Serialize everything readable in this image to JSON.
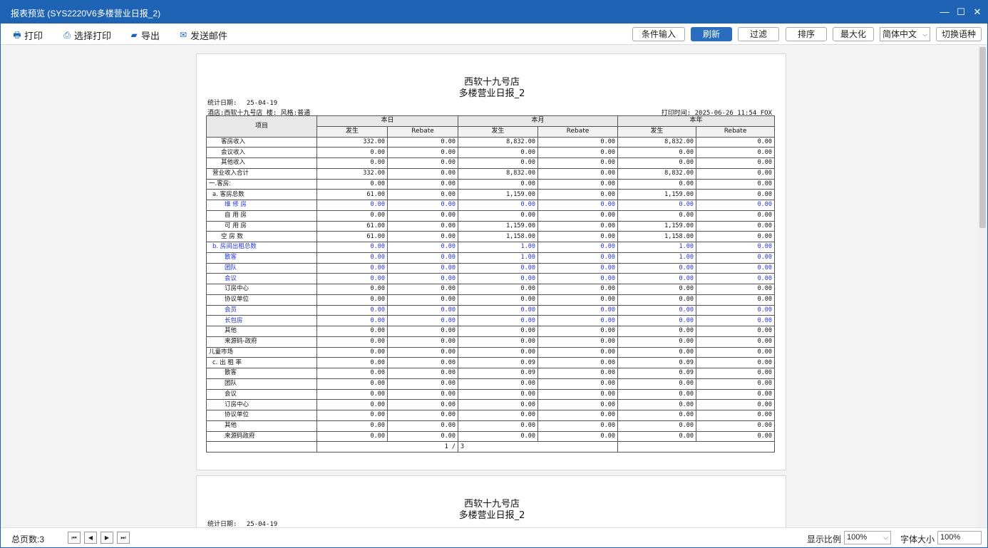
{
  "window": {
    "title": "报表预览 (SYS2220V6多楼营业日报_2)",
    "minimize": "—",
    "maximize": "☐",
    "close": "✕"
  },
  "toolbar": {
    "print": "打印",
    "select_print": "选择打印",
    "export": "导出",
    "send_mail": "发送邮件",
    "condition_input": "条件输入",
    "refresh": "刷新",
    "filter": "过滤",
    "sort": "排序",
    "maximize": "最大化",
    "language": "简体中文",
    "switch_language": "切换语种"
  },
  "report": {
    "hotel": "西软十九号店",
    "name": "多楼营业日报_2",
    "stat_date_label": "统计日期:",
    "stat_date": "25-04-19",
    "hotel_line": "酒店:西软十九号店 楼: 风格:普通",
    "print_time": "打印时间: 2025-06-26 11:54 FOX",
    "headers": {
      "item": "项目",
      "today": "本日",
      "month": "本月",
      "year": "本年",
      "occur": "发生",
      "rebate": "Rebate"
    },
    "rows": [
      {
        "item": "客房收入",
        "indent": 2,
        "blue": false,
        "v": [
          "332.00",
          "0.00",
          "8,832.00",
          "0.00",
          "8,832.00",
          "0.00"
        ]
      },
      {
        "item": "会议收入",
        "indent": 2,
        "blue": false,
        "v": [
          "0.00",
          "0.00",
          "0.00",
          "0.00",
          "0.00",
          "0.00"
        ]
      },
      {
        "item": "其他收入",
        "indent": 2,
        "blue": false,
        "v": [
          "0.00",
          "0.00",
          "0.00",
          "0.00",
          "0.00",
          "0.00"
        ]
      },
      {
        "item": "营业收入合计",
        "indent": 1,
        "blue": false,
        "v": [
          "332.00",
          "0.00",
          "8,832.00",
          "0.00",
          "8,832.00",
          "0.00"
        ]
      },
      {
        "item": "一.客房:",
        "indent": 0,
        "blue": false,
        "v": [
          "0.00",
          "0.00",
          "0.00",
          "0.00",
          "0.00",
          "0.00"
        ]
      },
      {
        "item": "a. 客房总数",
        "indent": 1,
        "blue": false,
        "v": [
          "61.00",
          "0.00",
          "1,159.00",
          "0.00",
          "1,159.00",
          "0.00"
        ]
      },
      {
        "item": "维 修 房",
        "indent": 3,
        "blue": true,
        "v": [
          "0.00",
          "0.00",
          "0.00",
          "0.00",
          "0.00",
          "0.00"
        ]
      },
      {
        "item": "自 用 房",
        "indent": 3,
        "blue": false,
        "v": [
          "0.00",
          "0.00",
          "0.00",
          "0.00",
          "0.00",
          "0.00"
        ]
      },
      {
        "item": "可 用 房",
        "indent": 3,
        "blue": false,
        "v": [
          "61.00",
          "0.00",
          "1,159.00",
          "0.00",
          "1,159.00",
          "0.00"
        ]
      },
      {
        "item": "空 房 数",
        "indent": 2,
        "blue": false,
        "v": [
          "61.00",
          "0.00",
          "1,158.00",
          "0.00",
          "1,158.00",
          "0.00"
        ]
      },
      {
        "item": "b. 房间出租总数",
        "indent": 1,
        "blue": true,
        "v": [
          "0.00",
          "0.00",
          "1.00",
          "0.00",
          "1.00",
          "0.00"
        ]
      },
      {
        "item": "散客",
        "indent": 3,
        "blue": true,
        "v": [
          "0.00",
          "0.00",
          "1.00",
          "0.00",
          "1.00",
          "0.00"
        ]
      },
      {
        "item": "团队",
        "indent": 3,
        "blue": true,
        "v": [
          "0.00",
          "0.00",
          "0.00",
          "0.00",
          "0.00",
          "0.00"
        ]
      },
      {
        "item": "会议",
        "indent": 3,
        "blue": true,
        "v": [
          "0.00",
          "0.00",
          "0.00",
          "0.00",
          "0.00",
          "0.00"
        ]
      },
      {
        "item": "订房中心",
        "indent": 3,
        "blue": false,
        "v": [
          "0.00",
          "0.00",
          "0.00",
          "0.00",
          "0.00",
          "0.00"
        ]
      },
      {
        "item": "协议单位",
        "indent": 3,
        "blue": false,
        "v": [
          "0.00",
          "0.00",
          "0.00",
          "0.00",
          "0.00",
          "0.00"
        ]
      },
      {
        "item": "会员",
        "indent": 3,
        "blue": true,
        "v": [
          "0.00",
          "0.00",
          "0.00",
          "0.00",
          "0.00",
          "0.00"
        ]
      },
      {
        "item": "长包房",
        "indent": 3,
        "blue": true,
        "v": [
          "0.00",
          "0.00",
          "0.00",
          "0.00",
          "0.00",
          "0.00"
        ]
      },
      {
        "item": "其他",
        "indent": 3,
        "blue": false,
        "v": [
          "0.00",
          "0.00",
          "0.00",
          "0.00",
          "0.00",
          "0.00"
        ]
      },
      {
        "item": "来源码-政府",
        "indent": 3,
        "blue": false,
        "v": [
          "0.00",
          "0.00",
          "0.00",
          "0.00",
          "0.00",
          "0.00"
        ]
      },
      {
        "item": "儿童市场",
        "indent": 0,
        "blue": false,
        "v": [
          "0.00",
          "0.00",
          "0.00",
          "0.00",
          "0.00",
          "0.00"
        ]
      },
      {
        "item": "c. 出 租 率",
        "indent": 1,
        "blue": false,
        "v": [
          "0.00",
          "0.00",
          "0.09",
          "0.00",
          "0.09",
          "0.00"
        ]
      },
      {
        "item": "散客",
        "indent": 3,
        "blue": false,
        "v": [
          "0.00",
          "0.00",
          "0.09",
          "0.00",
          "0.09",
          "0.00"
        ]
      },
      {
        "item": "团队",
        "indent": 3,
        "blue": false,
        "v": [
          "0.00",
          "0.00",
          "0.00",
          "0.00",
          "0.00",
          "0.00"
        ]
      },
      {
        "item": "会议",
        "indent": 3,
        "blue": false,
        "v": [
          "0.00",
          "0.00",
          "0.00",
          "0.00",
          "0.00",
          "0.00"
        ]
      },
      {
        "item": "订房中心",
        "indent": 3,
        "blue": false,
        "v": [
          "0.00",
          "0.00",
          "0.00",
          "0.00",
          "0.00",
          "0.00"
        ]
      },
      {
        "item": "协议单位",
        "indent": 3,
        "blue": false,
        "v": [
          "0.00",
          "0.00",
          "0.00",
          "0.00",
          "0.00",
          "0.00"
        ]
      },
      {
        "item": "其他",
        "indent": 3,
        "blue": false,
        "v": [
          "0.00",
          "0.00",
          "0.00",
          "0.00",
          "0.00",
          "0.00"
        ]
      },
      {
        "item": "来源码政府",
        "indent": 3,
        "blue": false,
        "v": [
          "0.00",
          "0.00",
          "0.00",
          "0.00",
          "0.00",
          "0.00"
        ]
      }
    ],
    "page_left": "1 /",
    "page_right": "3"
  },
  "statusbar": {
    "total_pages": "总页数:3",
    "first": "⏮",
    "prev": "◀",
    "next": "▶",
    "last": "⏭",
    "zoom_label": "显示比例",
    "zoom_value": "100%",
    "font_label": "字体大小",
    "font_value": "100%"
  }
}
